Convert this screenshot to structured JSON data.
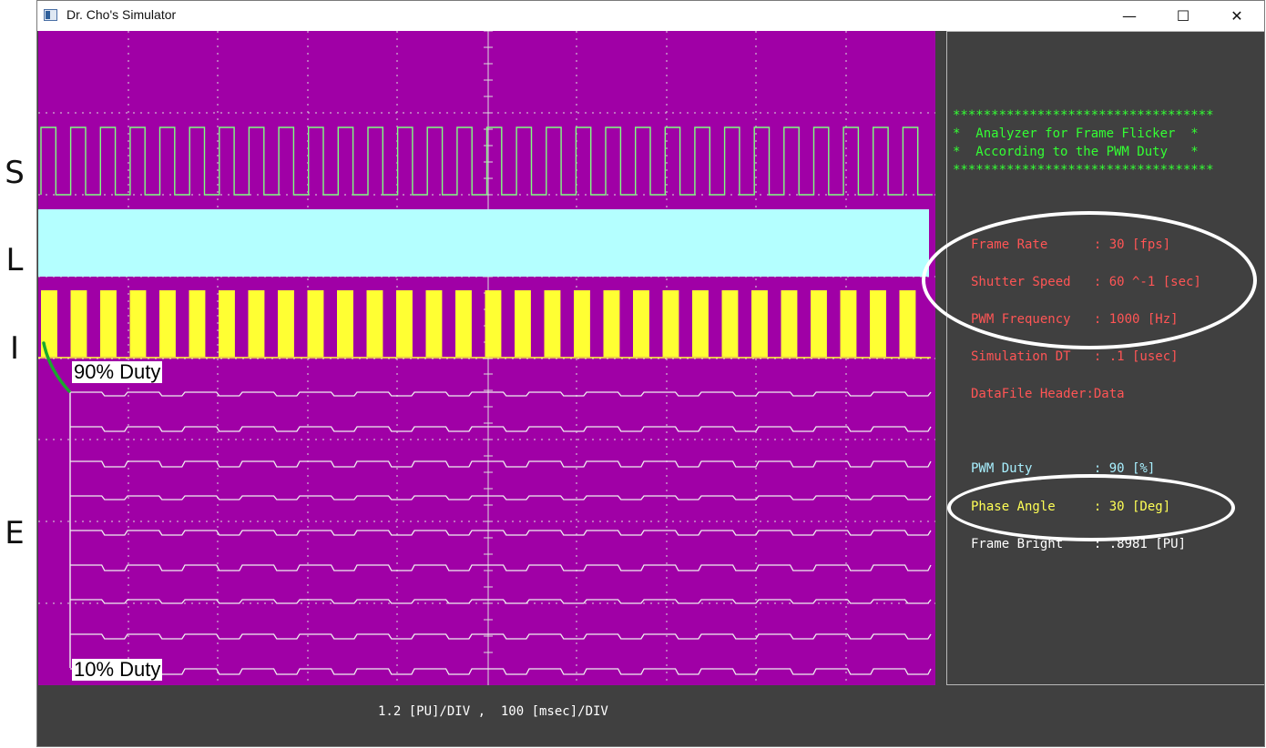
{
  "window": {
    "title": "Dr. Cho's Simulator",
    "controls": {
      "minimize": "—",
      "maximize": "☐",
      "close": "✕"
    }
  },
  "side_labels": [
    "S",
    "L",
    "I",
    "E"
  ],
  "scope": {
    "colors": {
      "background": "#a000a6",
      "grid": "#dcdcdc",
      "shutter": "#80ff80",
      "light": "#b4ffff",
      "pwm": "#ffff33",
      "frames": "#f0f0f0"
    },
    "shutter_cycles": 30,
    "pwm_pulses": 30,
    "frame_rows": 9,
    "duty_top_label": "90% Duty",
    "duty_bottom_label": "10% Duty"
  },
  "panel": {
    "banner": [
      "**********************************",
      "*  Analyzer for Frame Flicker  *",
      "*  According to the PWM Duty   *",
      "**********************************"
    ],
    "params": [
      {
        "label": "Frame Rate      ",
        "value": ": 30 [fps]",
        "color": "#ff5555"
      },
      {
        "label": "Shutter Speed   ",
        "value": ": 60 ^-1 [sec]",
        "color": "#ff5555"
      },
      {
        "label": "PWM Frequency   ",
        "value": ": 1000 [Hz]",
        "color": "#ff5555"
      },
      {
        "label": "Simulation DT   ",
        "value": ": .1 [usec]",
        "color": "#ff5555"
      },
      {
        "label": "DataFile Header",
        "value": ":Data",
        "color": "#ff5555"
      },
      {
        "label": "PWM Duty        ",
        "value": ": 90 [%]",
        "color": "#a8f0ff"
      },
      {
        "label": "Phase Angle     ",
        "value": ": 30 [Deg]",
        "color": "#ffff55"
      },
      {
        "label": "Frame Bright    ",
        "value": ": .8981 [PU]",
        "color": "#ffffff"
      }
    ]
  },
  "status": {
    "scale": "1.2 [PU]/DIV ,  100 [msec]/DIV"
  }
}
